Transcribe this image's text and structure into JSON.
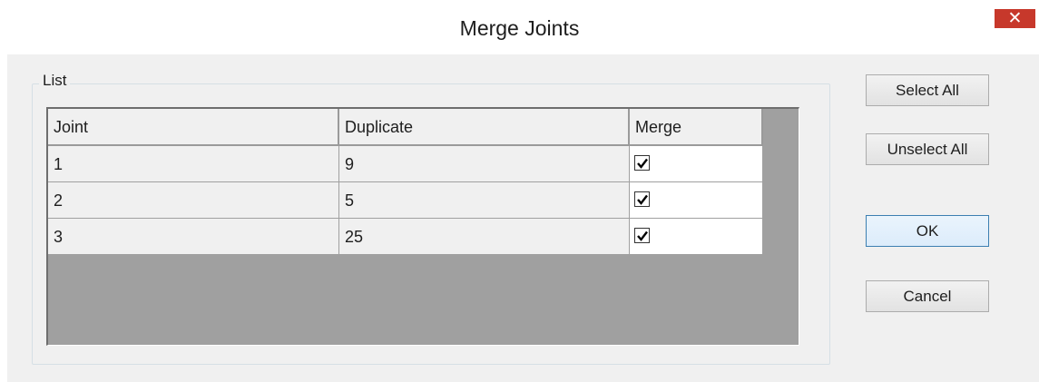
{
  "window": {
    "title": "Merge Joints",
    "close_glyph": "✕"
  },
  "group": {
    "label": "List"
  },
  "table": {
    "columns": [
      "Joint",
      "Duplicate",
      "Merge"
    ],
    "rows": [
      {
        "joint": "1",
        "duplicate": "9",
        "merge": true
      },
      {
        "joint": "2",
        "duplicate": "5",
        "merge": true
      },
      {
        "joint": "3",
        "duplicate": "25",
        "merge": true
      }
    ]
  },
  "buttons": {
    "select_all": "Select All",
    "unselect_all": "Unselect All",
    "ok": "OK",
    "cancel": "Cancel"
  },
  "colors": {
    "close": "#c7382b",
    "grid_background": "#a0a0a0",
    "dialog_background": "#f0f0f0"
  }
}
